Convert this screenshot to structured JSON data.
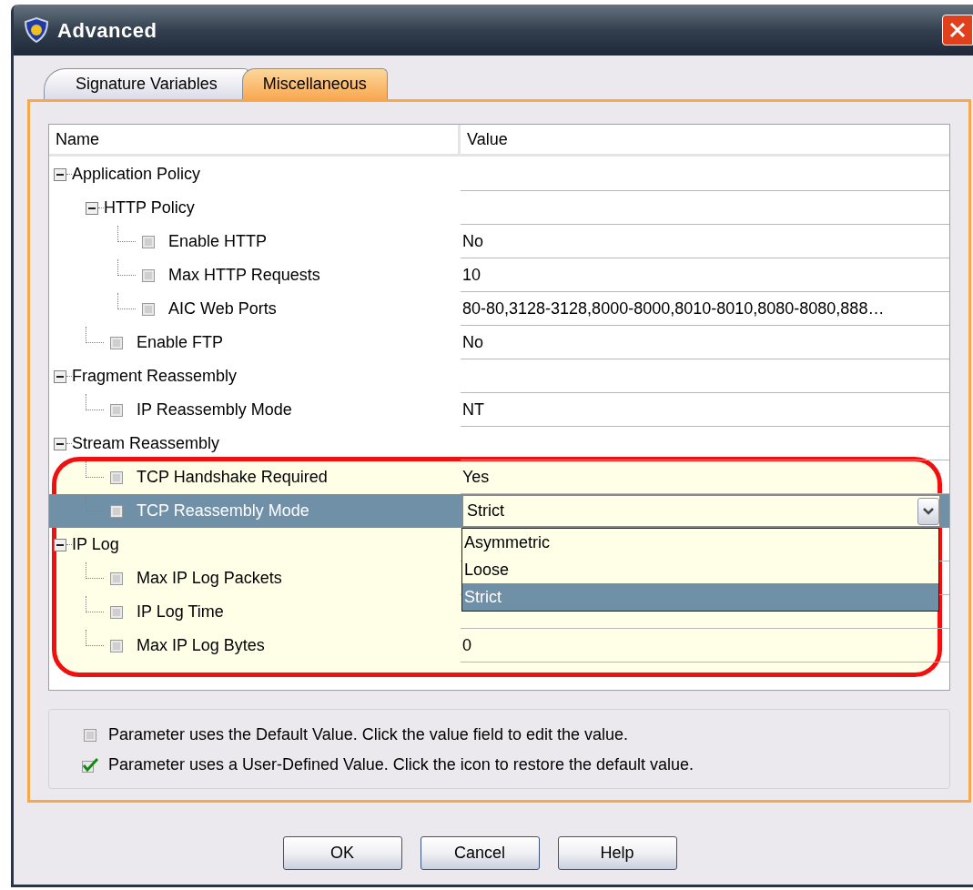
{
  "window": {
    "title": "Advanced"
  },
  "tabs": [
    {
      "label": "Signature Variables",
      "selected": false
    },
    {
      "label": "Miscellaneous",
      "selected": true
    }
  ],
  "table": {
    "columns": [
      "Name",
      "Value"
    ],
    "rows": [
      {
        "name": "Application Policy",
        "expanded": true,
        "selected": false,
        "children": [
          {
            "name": "HTTP Policy",
            "expanded": true,
            "selected": false,
            "children": [
              {
                "name": "Enable HTTP",
                "value": "No",
                "selected": false
              },
              {
                "name": "Max HTTP Requests",
                "value": "10",
                "selected": false
              },
              {
                "name": "AIC Web Ports",
                "value": "80-80,3128-3128,8000-8000,8010-8010,8080-8080,888…",
                "selected": false
              }
            ]
          },
          {
            "name": "Enable FTP",
            "value": "No",
            "selected": false
          }
        ]
      },
      {
        "name": "Fragment Reassembly",
        "expanded": true,
        "selected": false,
        "children": [
          {
            "name": "IP Reassembly Mode",
            "value": "NT",
            "selected": false
          }
        ]
      },
      {
        "name": "Stream Reassembly",
        "expanded": true,
        "selected": false,
        "children": [
          {
            "name": "TCP Handshake Required",
            "value": "Yes",
            "selected": false
          },
          {
            "name": "TCP Reassembly Mode",
            "selected": true,
            "editor": {
              "value": "Strict",
              "options": [
                {
                  "label": "Asymmetric",
                  "selected": false
                },
                {
                  "label": "Loose",
                  "selected": false
                },
                {
                  "label": "Strict",
                  "selected": true
                }
              ]
            }
          }
        ]
      },
      {
        "name": "IP Log",
        "expanded": true,
        "selected": false,
        "children": [
          {
            "name": "Max IP Log Packets",
            "selected": false
          },
          {
            "name": "IP Log Time",
            "selected": false
          },
          {
            "name": "Max IP Log Bytes",
            "value": "0",
            "selected": false
          }
        ]
      }
    ]
  },
  "legend": [
    {
      "kind": "default",
      "text": "Parameter uses the Default Value.  Click the value field to edit the value."
    },
    {
      "kind": "user_defined",
      "text": "Parameter uses a User-Defined Value.  Click the icon to restore the default value."
    }
  ],
  "buttons": [
    "OK",
    "Cancel",
    "Help"
  ]
}
